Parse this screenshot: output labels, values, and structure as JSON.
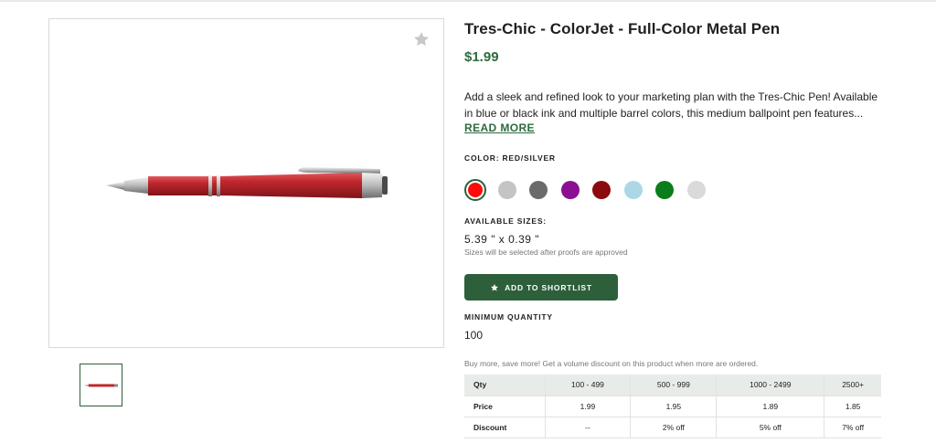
{
  "product": {
    "title": "Tres-Chic - ColorJet - Full-Color Metal Pen",
    "price": "$1.99",
    "description": "Add a sleek and refined look to your marketing plan with the Tres-Chic Pen! Available in blue or black ink and multiple barrel colors, this medium ballpoint pen features...",
    "read_more": "READ MORE",
    "favorite_icon": "star-icon"
  },
  "color": {
    "label": "COLOR: RED/SILVER",
    "swatches": [
      {
        "name": "red",
        "hex": "#ff0a0a",
        "selected": true
      },
      {
        "name": "light-gray",
        "hex": "#c4c4c4",
        "selected": false
      },
      {
        "name": "dark-gray",
        "hex": "#6b6b6b",
        "selected": false
      },
      {
        "name": "purple",
        "hex": "#8a0f92",
        "selected": false
      },
      {
        "name": "burgundy",
        "hex": "#8b0a0d",
        "selected": false
      },
      {
        "name": "light-blue",
        "hex": "#acd8e6",
        "selected": false
      },
      {
        "name": "green",
        "hex": "#0c7d1b",
        "selected": false
      },
      {
        "name": "silver",
        "hex": "#dadada",
        "selected": false
      }
    ]
  },
  "sizes": {
    "label": "AVAILABLE SIZES:",
    "value": "5.39 \" x 0.39 \"",
    "note": "Sizes will be selected after proofs are approved"
  },
  "shortlist": {
    "label": "ADD TO SHORTLIST",
    "icon": "star-icon"
  },
  "minimum_quantity": {
    "label": "MINIMUM QUANTITY",
    "value": "100"
  },
  "volume_note": "Buy more, save more! Get a volume discount on this product when more are ordered.",
  "pricing_table": {
    "headers": [
      "Qty",
      "100 - 499",
      "500 - 999",
      "1000 - 2499",
      "2500+"
    ],
    "rows": [
      [
        "Price",
        "1.99",
        "1.95",
        "1.89",
        "1.85"
      ],
      [
        "Discount",
        "--",
        "2% off",
        "5% off",
        "7% off"
      ]
    ]
  },
  "colors": {
    "brand_green": "#2d5f3a",
    "price_green": "#2d6b3d",
    "pen_red": "#c0272d"
  }
}
